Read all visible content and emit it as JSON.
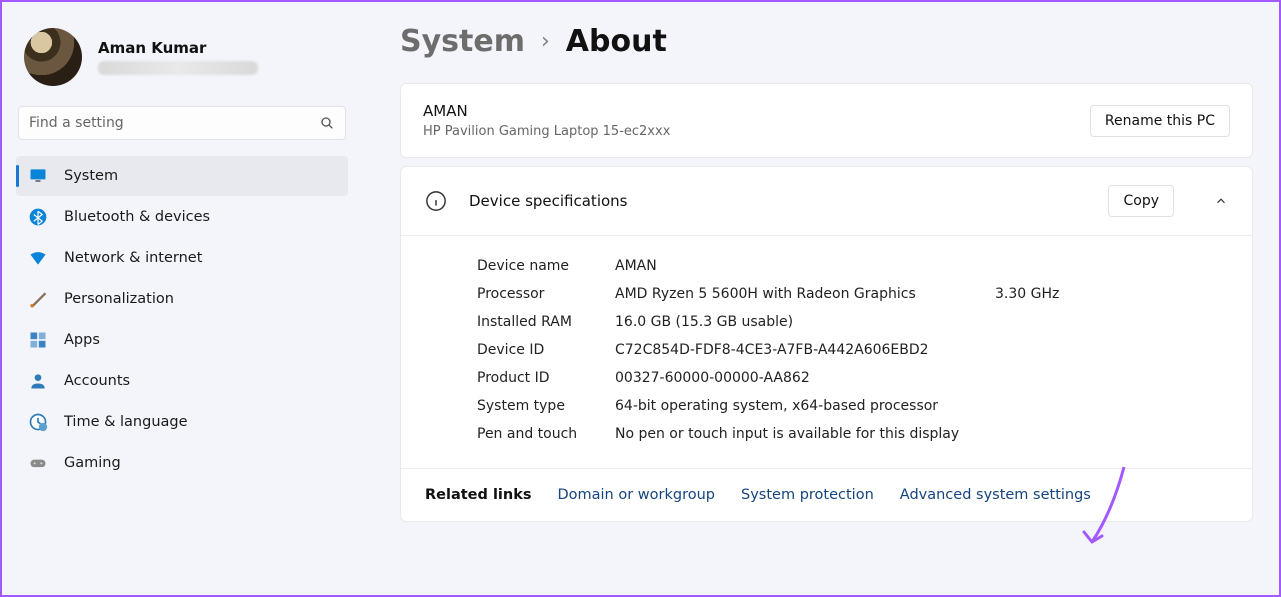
{
  "user": {
    "name": "Aman Kumar"
  },
  "search": {
    "placeholder": "Find a setting"
  },
  "nav": [
    {
      "label": "System",
      "icon": "display",
      "active": true
    },
    {
      "label": "Bluetooth & devices",
      "icon": "bluetooth"
    },
    {
      "label": "Network & internet",
      "icon": "wifi"
    },
    {
      "label": "Personalization",
      "icon": "brush"
    },
    {
      "label": "Apps",
      "icon": "apps"
    },
    {
      "label": "Accounts",
      "icon": "person"
    },
    {
      "label": "Time & language",
      "icon": "clock"
    },
    {
      "label": "Gaming",
      "icon": "gamepad"
    }
  ],
  "breadcrumb": {
    "parent": "System",
    "current": "About"
  },
  "pc": {
    "name": "AMAN",
    "model": "HP Pavilion Gaming Laptop 15-ec2xxx",
    "rename": "Rename this PC"
  },
  "section": {
    "title": "Device specifications",
    "copy": "Copy"
  },
  "specs": [
    {
      "label": "Device name",
      "value": "AMAN",
      "extra": ""
    },
    {
      "label": "Processor",
      "value": "AMD Ryzen 5 5600H with Radeon Graphics",
      "extra": "3.30 GHz"
    },
    {
      "label": "Installed RAM",
      "value": "16.0 GB (15.3 GB usable)",
      "extra": ""
    },
    {
      "label": "Device ID",
      "value": "C72C854D-FDF8-4CE3-A7FB-A442A606EBD2",
      "extra": ""
    },
    {
      "label": "Product ID",
      "value": "00327-60000-00000-AA862",
      "extra": ""
    },
    {
      "label": "System type",
      "value": "64-bit operating system, x64-based processor",
      "extra": ""
    },
    {
      "label": "Pen and touch",
      "value": "No pen or touch input is available for this display",
      "extra": ""
    }
  ],
  "related": {
    "label": "Related links",
    "links": [
      "Domain or workgroup",
      "System protection",
      "Advanced system settings"
    ]
  }
}
